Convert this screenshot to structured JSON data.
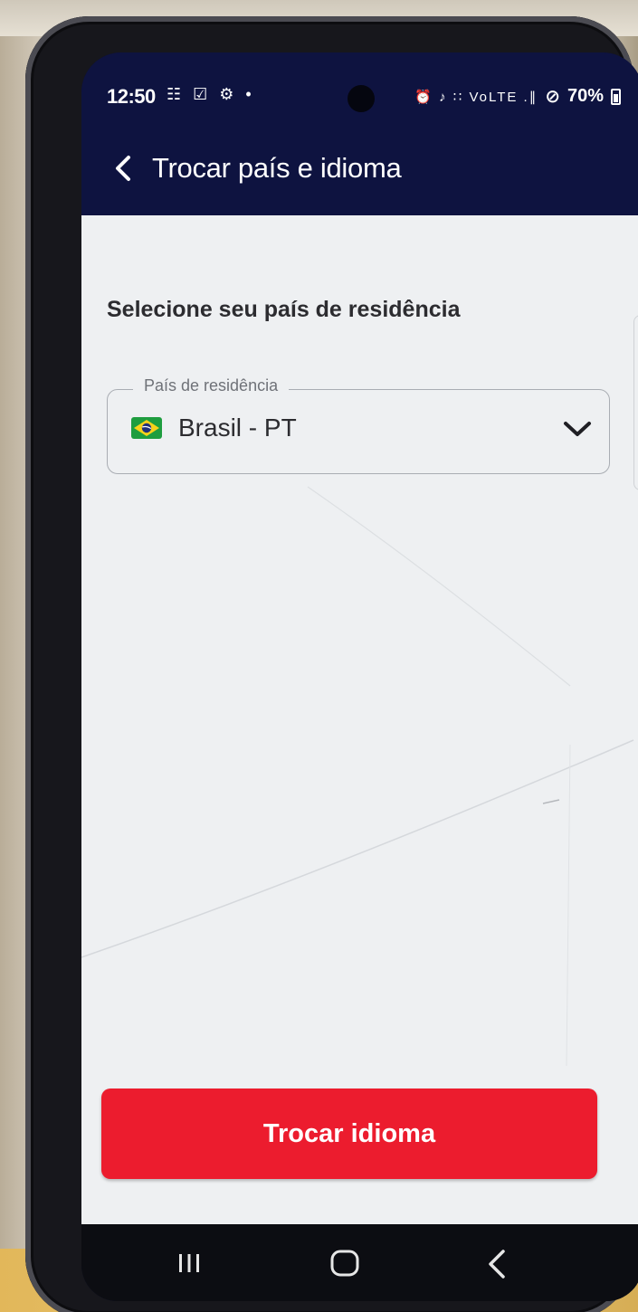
{
  "status_bar": {
    "time": "12:50",
    "left_icons": "☷ ☑ ⚙ •",
    "right_signal_icons": "⏰ ♪ ∷ VoLTE .∥",
    "block_icon": "⊘",
    "battery": "70%"
  },
  "app_bar": {
    "title": "Trocar país e idioma",
    "back_icon": "chevron-left"
  },
  "main": {
    "section_title": "Selecione seu país de residência",
    "country_select": {
      "label": "País de residência",
      "value": "Brasil - PT",
      "flag_icon": "brazil-flag",
      "dropdown_icon": "chevron-down"
    },
    "primary_button": {
      "label": "Trocar idioma",
      "color": "#ec1c2e"
    }
  },
  "colors": {
    "app_bar_bg": "#0e1340",
    "content_bg": "#eef0f2",
    "accent": "#ec1c2e"
  },
  "nav_bar": {
    "recents_icon": "recents",
    "home_icon": "home",
    "back_icon": "back"
  }
}
